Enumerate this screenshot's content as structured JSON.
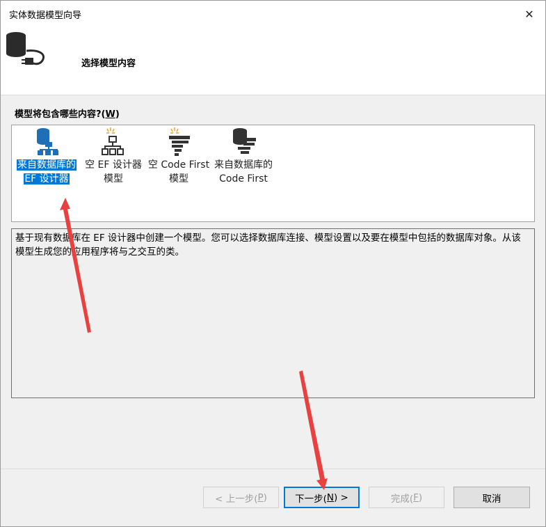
{
  "window": {
    "title": "实体数据模型向导",
    "close_symbol": "✕"
  },
  "header": {
    "title": "选择模型内容",
    "icon": "database-plug-icon"
  },
  "question": {
    "label": "模型将包含哪些内容?(",
    "mnemonic": "W",
    "suffix": ")"
  },
  "items": [
    {
      "line1": "来自数据库的",
      "line2": "EF 设计器",
      "icon": "database-hierarchy-icon",
      "selected": true
    },
    {
      "line1": "空 EF 设计器",
      "line2": "模型",
      "icon": "empty-hierarchy-icon",
      "selected": false
    },
    {
      "line1": "空 Code First",
      "line2": "模型",
      "icon": "empty-code-first-icon",
      "selected": false
    },
    {
      "line1": "来自数据库的",
      "line2": "Code First",
      "icon": "database-code-first-icon",
      "selected": false
    }
  ],
  "description": "基于现有数据库在 EF 设计器中创建一个模型。您可以选择数据库连接、模型设置以及要在模型中包括的数据库对象。从该模型生成您的应用程序将与之交互的类。",
  "buttons": {
    "prev": {
      "prefix": "< 上一步(",
      "key": "P",
      "suffix": ")"
    },
    "next": {
      "prefix": "下一步(",
      "key": "N",
      "suffix": ") >"
    },
    "finish": {
      "prefix": "完成(",
      "key": "F",
      "suffix": ")"
    },
    "cancel": {
      "label": "取消"
    }
  },
  "colors": {
    "selection": "#0078d7",
    "annotation_arrow": "#e8413f"
  }
}
